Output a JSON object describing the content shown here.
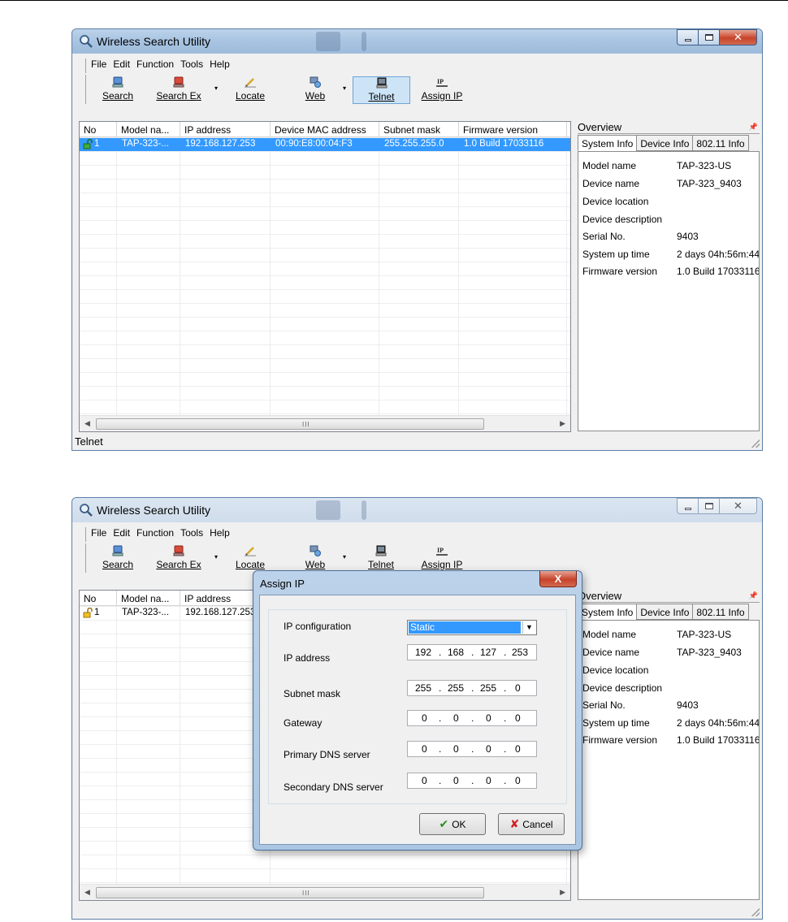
{
  "window1": {
    "title": "Wireless Search Utility",
    "menu": [
      "File",
      "Edit",
      "Function",
      "Tools",
      "Help"
    ],
    "toolbar": {
      "search": "Search",
      "search_ex": "Search Ex",
      "locate": "Locate",
      "web": "Web",
      "telnet": "Telnet",
      "assign_ip": "Assign IP",
      "active": "Telnet"
    },
    "columns": [
      "No",
      "Model na...",
      "IP address",
      "Device MAC address",
      "Subnet mask",
      "Firmware version"
    ],
    "row": {
      "no": "1",
      "model": "TAP-323-...",
      "ip": "192.168.127.253",
      "mac": "00:90:E8:00:04:F3",
      "subnet": "255.255.255.0",
      "firmware": "1.0 Build 17033116"
    },
    "scroll_grip": "III",
    "overview": {
      "title": "Overview",
      "tabs": [
        "System Info",
        "Device Info",
        "802.11 Info"
      ],
      "info": [
        {
          "label": "Model name",
          "value": "TAP-323-US"
        },
        {
          "label": "Device name",
          "value": "TAP-323_9403"
        },
        {
          "label": "Device location",
          "value": ""
        },
        {
          "label": "Device description",
          "value": ""
        },
        {
          "label": "Serial No.",
          "value": "9403"
        },
        {
          "label": "System up time",
          "value": "2 days 04h:56m:44"
        },
        {
          "label": "Firmware version",
          "value": "1.0 Build 17033116"
        }
      ]
    },
    "status": "Telnet"
  },
  "window2": {
    "title": "Wireless Search Utility",
    "menu": [
      "File",
      "Edit",
      "Function",
      "Tools",
      "Help"
    ],
    "toolbar": {
      "search": "Search",
      "search_ex": "Search Ex",
      "locate": "Locate",
      "web": "Web",
      "telnet": "Telnet",
      "assign_ip": "Assign IP"
    },
    "columns": [
      "No",
      "Model na...",
      "IP address"
    ],
    "row": {
      "no": "1",
      "model": "TAP-323-...",
      "ip": "192.168.127.253"
    },
    "scroll_grip": "III",
    "overview": {
      "title": "Overview",
      "tabs": [
        "System Info",
        "Device Info",
        "802.11 Info"
      ],
      "info": [
        {
          "label": "Model name",
          "value": "TAP-323-US"
        },
        {
          "label": "Device name",
          "value": "TAP-323_9403"
        },
        {
          "label": "Device location",
          "value": ""
        },
        {
          "label": "Device description",
          "value": ""
        },
        {
          "label": "Serial No.",
          "value": "9403"
        },
        {
          "label": "System up time",
          "value": "2 days 04h:56m:44"
        },
        {
          "label": "Firmware version",
          "value": "1.0 Build 17033116"
        }
      ]
    }
  },
  "dialog": {
    "title": "Assign IP",
    "close": "X",
    "fields": {
      "ip_config_label": "IP configuration",
      "ip_config_value": "Static",
      "ip_address_label": "IP address",
      "ip_address": [
        "192",
        "168",
        "127",
        "253"
      ],
      "subnet_label": "Subnet mask",
      "subnet": [
        "255",
        "255",
        "255",
        "0"
      ],
      "gateway_label": "Gateway",
      "gateway": [
        "0",
        "0",
        "0",
        "0"
      ],
      "primary_dns_label": "Primary DNS server",
      "primary_dns": [
        "0",
        "0",
        "0",
        "0"
      ],
      "secondary_dns_label": "Secondary DNS server",
      "secondary_dns": [
        "0",
        "0",
        "0",
        "0"
      ]
    },
    "ok": "OK",
    "cancel": "Cancel"
  }
}
